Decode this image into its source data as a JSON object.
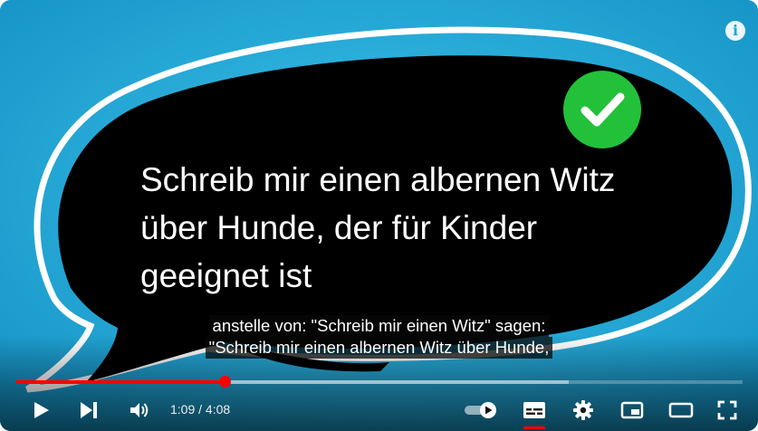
{
  "video": {
    "slide_lines": [
      "Schreib mir einen albernen Witz",
      "über Hunde, der für Kinder",
      "geeignet ist"
    ],
    "captions": [
      "anstelle von: \"Schreib mir einen Witz\" sagen:",
      "\"Schreib mir einen albernen Witz über Hunde,"
    ],
    "info_label": "i"
  },
  "player": {
    "current_time": "1:09",
    "separator": " / ",
    "duration": "4:08",
    "progress_fraction": 0.287,
    "buffered_fraction": 0.76,
    "autoplay_on": true,
    "subtitles_on": true
  },
  "colors": {
    "background_blue": "#1fa6d3",
    "bubble": "#000000",
    "check_green": "#23c13a",
    "progress_red": "#ff0000"
  },
  "icons": [
    "play-icon",
    "next-icon",
    "volume-icon",
    "autoplay-toggle-icon",
    "subtitles-icon",
    "settings-gear-icon",
    "miniplayer-icon",
    "theater-mode-icon",
    "fullscreen-icon",
    "info-icon",
    "checkmark-icon"
  ]
}
